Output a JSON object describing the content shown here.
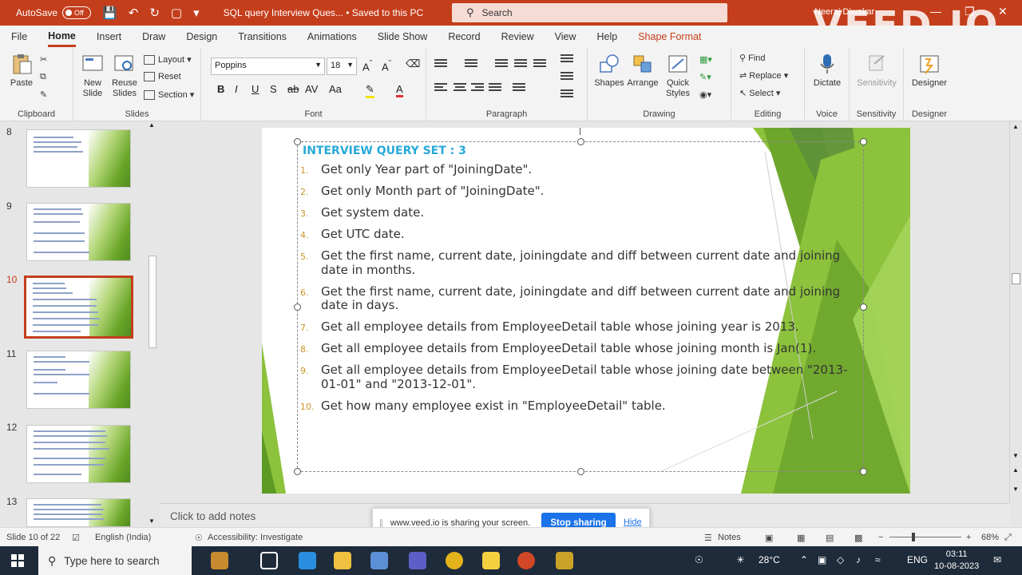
{
  "titlebar": {
    "autosave_label": "AutoSave",
    "autosave_state": "Off",
    "doc_title": "SQL query Interview Ques... • Saved to this PC",
    "search_placeholder": "Search",
    "user_name": "Neeraj Diwakar",
    "watermark": "VEED.IO"
  },
  "menu_tabs": [
    "File",
    "Home",
    "Insert",
    "Draw",
    "Design",
    "Transitions",
    "Animations",
    "Slide Show",
    "Record",
    "Review",
    "View",
    "Help",
    "Shape Format"
  ],
  "ribbon": {
    "clipboard": {
      "paste": "Paste",
      "label": "Clipboard"
    },
    "slides": {
      "new_slide": "New Slide",
      "reuse_slides": "Reuse Slides",
      "layout": "Layout",
      "reset": "Reset",
      "section": "Section",
      "label": "Slides"
    },
    "font": {
      "font_name": "Poppins",
      "font_size": "18",
      "label": "Font"
    },
    "paragraph": {
      "label": "Paragraph"
    },
    "drawing": {
      "shapes": "Shapes",
      "arrange": "Arrange",
      "quick_styles": "Quick Styles",
      "label": "Drawing"
    },
    "editing": {
      "find": "Find",
      "replace": "Replace",
      "select": "Select",
      "label": "Editing"
    },
    "voice": {
      "dictate": "Dictate",
      "label": "Voice"
    },
    "sensitivity": {
      "sensitivity": "Sensitivity",
      "label": "Sensitivity"
    },
    "designer": {
      "designer": "Designer",
      "label": "Designer"
    }
  },
  "thumbnails": [
    "8",
    "9",
    "10",
    "11",
    "12",
    "13"
  ],
  "selected_slide": "10",
  "slide": {
    "title": "INTERVIEW QUERY SET : 3",
    "items": [
      "Get only Year part of \"JoiningDate\".",
      "Get only Month part of \"JoiningDate\".",
      "Get system date.",
      "Get UTC date.",
      "Get the first name, current date, joiningdate and diff between current date and joining date in months.",
      "Get the first name, current date, joiningdate and diff between current date and joining date in days.",
      "Get all employee details from EmployeeDetail table whose joining year is 2013.",
      "Get all employee details from EmployeeDetail table whose joining month is Jan(1).",
      "Get all employee details from EmployeeDetail table whose joining date between \"2013-01-01\" and \"2013-12-01\".",
      "Get how many employee exist in \"EmployeeDetail\" table."
    ],
    "numbers": [
      "1.",
      "2.",
      "3.",
      "4.",
      "5.",
      "6.",
      "7.",
      "8.",
      "9.",
      "10."
    ]
  },
  "notes_placeholder": "Click to add notes",
  "share_bar": {
    "message": "www.veed.io is sharing your screen.",
    "stop": "Stop sharing",
    "hide": "Hide"
  },
  "statusbar": {
    "slide_count": "Slide 10 of 22",
    "language": "English (India)",
    "accessibility": "Accessibility: Investigate",
    "notes": "Notes",
    "zoom": "68%"
  },
  "taskbar": {
    "search_placeholder": "Type here to search",
    "weather": "28°C",
    "lang": "ENG",
    "time": "03:11",
    "date": "10-08-2023"
  }
}
